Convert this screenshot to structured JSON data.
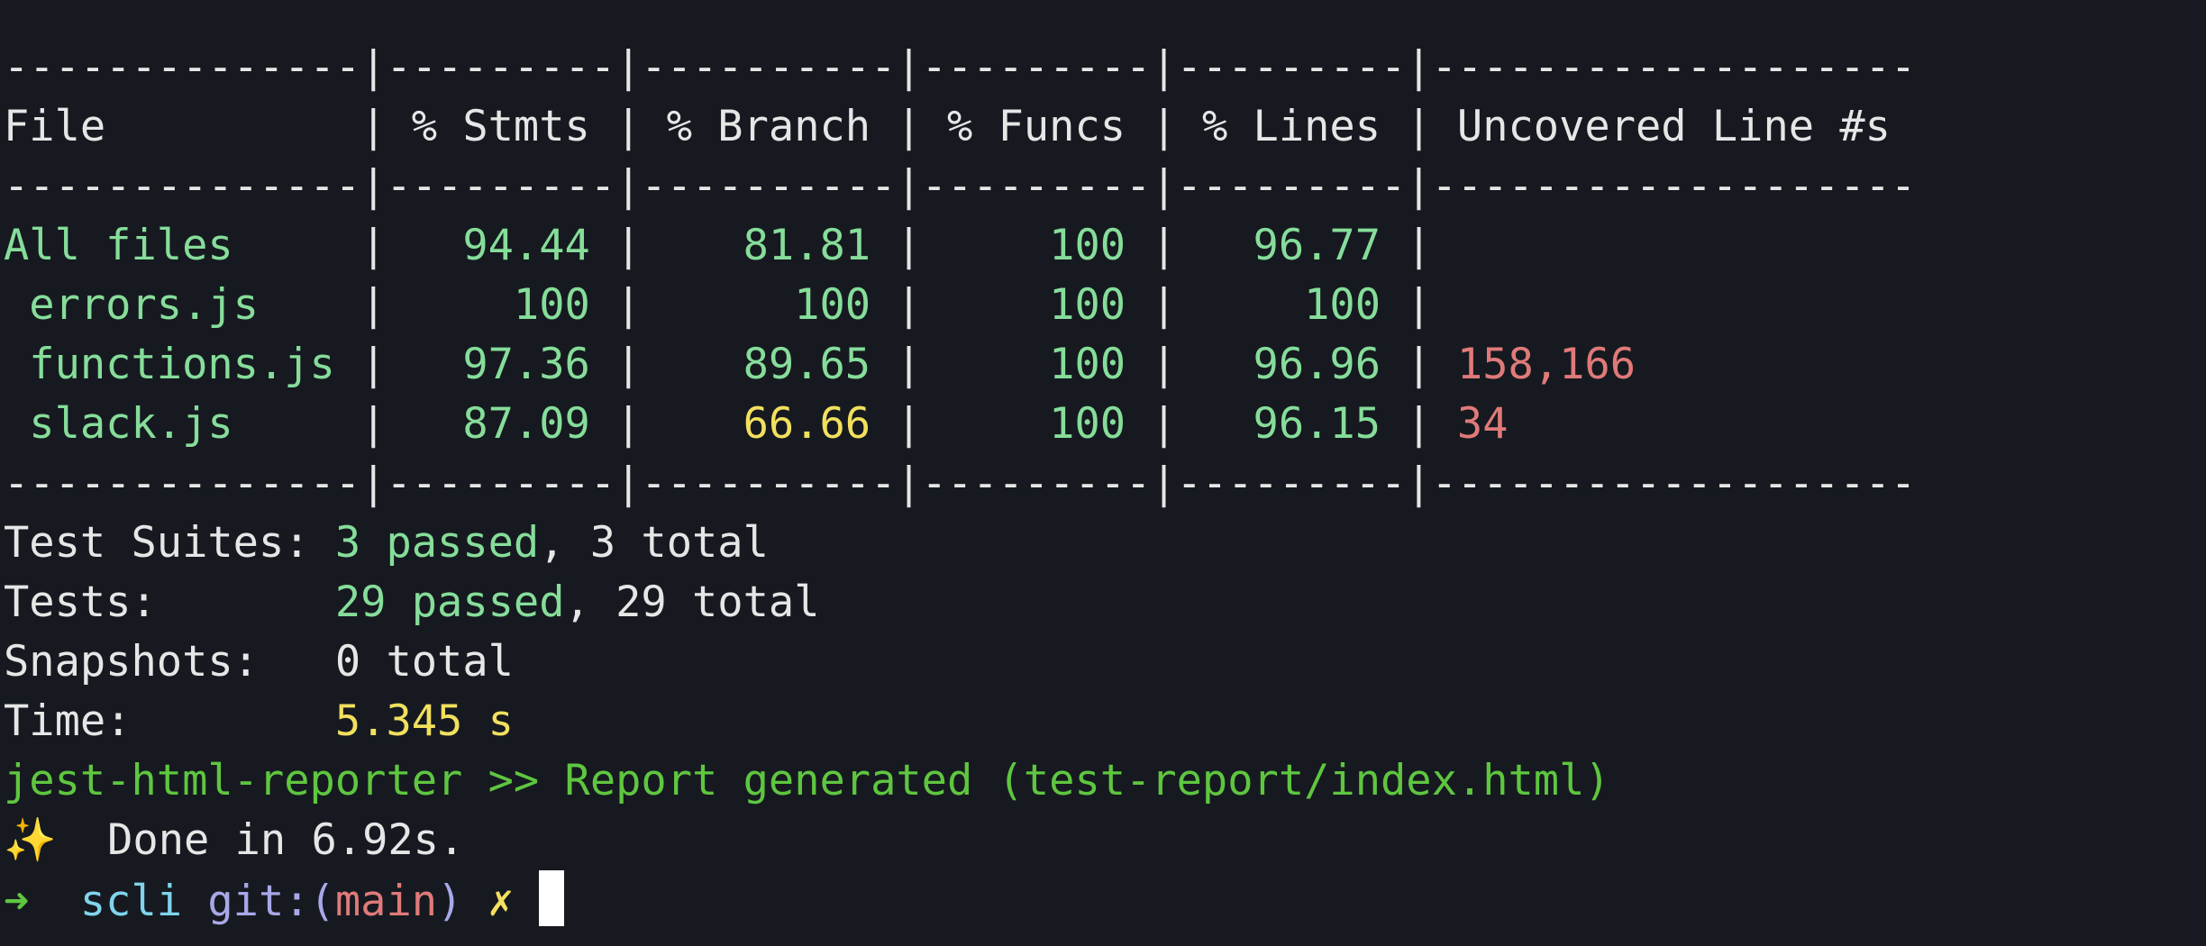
{
  "table": {
    "separator": "--------------|---------|----------|---------|---------|-------------------",
    "header": {
      "file": "File          ",
      "sep": " | ",
      "stmts": "% Stmts",
      "branch": "% Branch",
      "funcs": "% Funcs",
      "lines": "% Lines",
      "uncovered": "Uncovered Line #s"
    },
    "rows": [
      {
        "file": "All files     ",
        "stmts": "  94.44",
        "branch": "   81.81",
        "funcs": "    100",
        "lines": "  96.77",
        "uncovered": "",
        "branch_color": "green"
      },
      {
        "file": " errors.js    ",
        "stmts": "    100",
        "branch": "     100",
        "funcs": "    100",
        "lines": "    100",
        "uncovered": "",
        "branch_color": "green"
      },
      {
        "file": " functions.js ",
        "stmts": "  97.36",
        "branch": "   89.65",
        "funcs": "    100",
        "lines": "  96.96",
        "uncovered": "158,166",
        "branch_color": "green"
      },
      {
        "file": " slack.js     ",
        "stmts": "  87.09",
        "branch": "   66.66",
        "funcs": "    100",
        "lines": "  96.15",
        "uncovered": "34",
        "branch_color": "yellow"
      }
    ]
  },
  "summary": {
    "suites_label": "Test Suites: ",
    "suites_passed": "3 passed",
    "suites_total": ", 3 total",
    "tests_label": "Tests:       ",
    "tests_passed": "29 passed",
    "tests_total": ", 29 total",
    "snapshots_label": "Snapshots:   ",
    "snapshots_total": "0 total",
    "time_label": "Time:        ",
    "time_value": "5.345 s"
  },
  "reporter_line": "jest-html-reporter >> Report generated (test-report/index.html)",
  "done_line": {
    "sparkle": "✨",
    "text": "  Done in 6.92s."
  },
  "prompt": {
    "arrow": "➜",
    "dir": "scli",
    "git_label": "git:(",
    "branch": "main",
    "git_close": ")",
    "dirty": "✗"
  },
  "colors": {
    "background": "#161a20",
    "text": "#e6e6e6",
    "green": "#86dd9a",
    "yellow": "#f2e05e",
    "red": "#e07a7a",
    "bright_green": "#5fc640",
    "cyan": "#7fd4ec",
    "purple": "#a8a8e8"
  }
}
